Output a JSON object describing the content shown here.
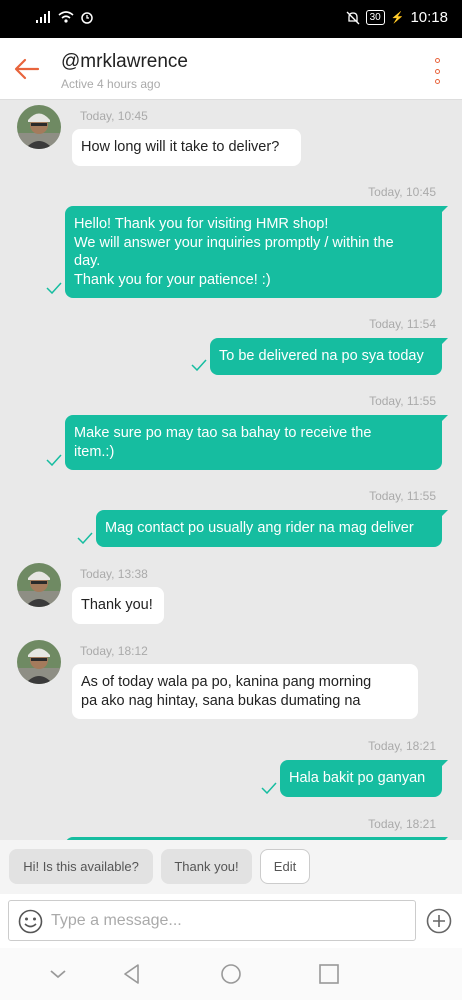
{
  "status_bar": {
    "battery": "30",
    "time": "10:18"
  },
  "header": {
    "title": "@mrklawrence",
    "subtitle": "Active 4 hours ago"
  },
  "messages": [
    {
      "ts": "Today, 10:45",
      "lines": [
        "How long will it take to deliver?"
      ]
    },
    {
      "ts": "Today, 10:45",
      "lines": [
        "Hello! Thank you for visiting HMR shop!",
        "We will answer your inquiries promptly / within the",
        "day.",
        "Thank you for your patience! :)"
      ]
    },
    {
      "ts": "Today, 11:54",
      "lines": [
        "To be delivered na po sya today"
      ]
    },
    {
      "ts": "Today, 11:55",
      "lines": [
        "Make sure po may tao sa bahay to receive the",
        "item.:)"
      ]
    },
    {
      "ts": "Today, 11:55",
      "lines": [
        "Mag contact po usually ang rider na mag deliver"
      ]
    },
    {
      "ts": "Today, 13:38",
      "lines": [
        "Thank you!"
      ]
    },
    {
      "ts": "Today, 18:12",
      "lines": [
        "As of today wala pa po, kanina pang morning",
        "pa ako nag hintay, sana bukas dumating na"
      ]
    },
    {
      "ts": "Today, 18:21",
      "lines": [
        "Hala bakit po ganyan"
      ]
    },
    {
      "ts": "Today, 18:21"
    }
  ],
  "quick_replies": [
    "Hi! Is this available?",
    "Thank you!",
    "Edit"
  ],
  "input": {
    "placeholder": "Type a message..."
  }
}
